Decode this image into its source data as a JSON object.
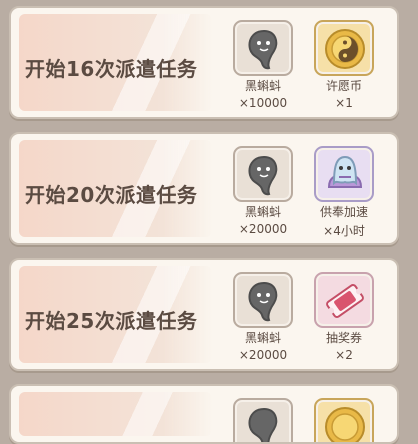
{
  "tasks": [
    {
      "title": "开始16次派遣任务",
      "rewards": [
        {
          "icon": "black-tadpole-icon",
          "name": "黑蝌蚪",
          "qty": "×10000"
        },
        {
          "icon": "wish-coin-icon",
          "name": "许愿币",
          "qty": "×1"
        }
      ]
    },
    {
      "title": "开始20次派遣任务",
      "rewards": [
        {
          "icon": "black-tadpole-icon",
          "name": "黑蝌蚪",
          "qty": "×20000"
        },
        {
          "icon": "offering-speedup-icon",
          "name": "供奉加速",
          "qty": "×4小时"
        }
      ]
    },
    {
      "title": "开始25次派遣任务",
      "rewards": [
        {
          "icon": "black-tadpole-icon",
          "name": "黑蝌蚪",
          "qty": "×20000"
        },
        {
          "icon": "lottery-ticket-icon",
          "name": "抽奖券",
          "qty": "×2"
        }
      ]
    }
  ],
  "colors": {
    "background": "#b9ada3",
    "card": "#fbf6ef",
    "text": "#5b4b42"
  }
}
